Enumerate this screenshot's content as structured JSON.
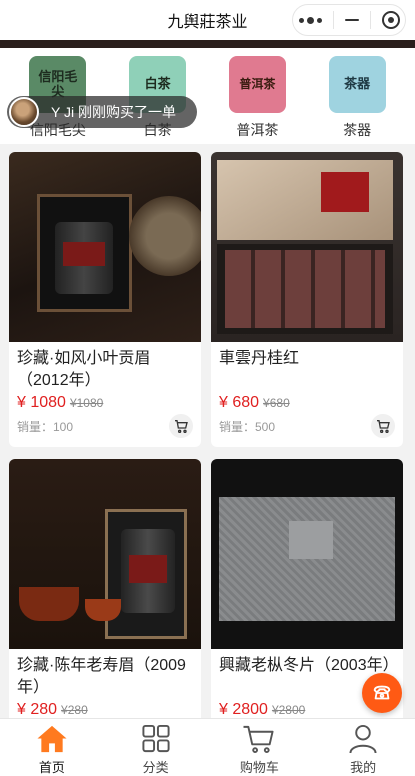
{
  "app": {
    "title": "九舆莊茶业"
  },
  "categories": [
    {
      "label": "信阳毛尖",
      "icon_text": "信阳毛尖",
      "color": "#5a8a66"
    },
    {
      "label": "白茶",
      "icon_text": "白茶",
      "color": "#8fd0b8"
    },
    {
      "label": "普洱茶",
      "icon_text": "普洱茶",
      "color": "#e07a90"
    },
    {
      "label": "茶器",
      "icon_text": "茶器",
      "color": "#9fd3e0"
    }
  ],
  "notice": {
    "text": "Y Ji 刚刚购买了一单"
  },
  "products": [
    {
      "name": "珍藏·如风小叶贡眉（2012年）",
      "price": "¥ 1080",
      "original_price": "¥1080",
      "sales": "销量：100"
    },
    {
      "name": "車雲丹桂红",
      "price": "¥ 680",
      "original_price": "¥680",
      "sales": "销量：500"
    },
    {
      "name": "珍藏·陈年老寿眉（2009年）",
      "price": "¥ 280",
      "original_price": "¥280",
      "sales": ""
    },
    {
      "name": "興藏老枞冬片（2003年）",
      "price": "¥ 2800",
      "original_price": "¥2800",
      "sales": ""
    }
  ],
  "tabbar": {
    "items": [
      {
        "label": "首页",
        "icon": "home-icon",
        "active": true
      },
      {
        "label": "分类",
        "icon": "grid-icon",
        "active": false
      },
      {
        "label": "购物车",
        "icon": "cart-icon",
        "active": false
      },
      {
        "label": "我的",
        "icon": "user-icon",
        "active": false
      }
    ]
  },
  "colors": {
    "accent": "#ff7a1f",
    "price": "#e02020",
    "fab": "#ff5a14"
  }
}
